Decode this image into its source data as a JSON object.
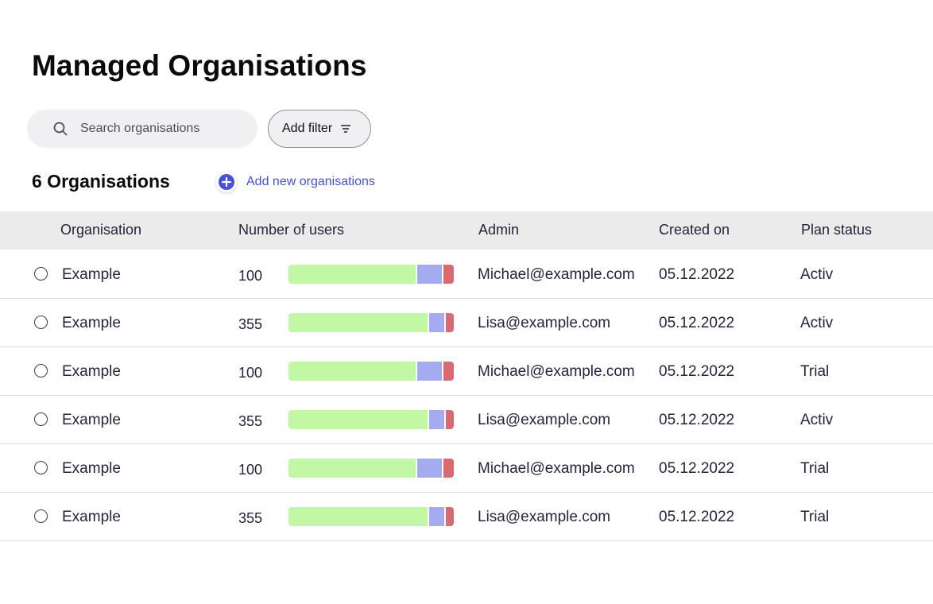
{
  "page": {
    "title": "Managed Organisations"
  },
  "search": {
    "placeholder": "Search organisations",
    "icon": "search-icon"
  },
  "filter": {
    "label": "Add filter",
    "icon": "filter-lines-icon"
  },
  "summary": {
    "count_label": "6 Organisations",
    "add_label": "Add new organisations",
    "add_icon": "plus-circle-icon"
  },
  "colors": {
    "accent": "#4751d6",
    "bar_green": "#c2f7a3",
    "bar_purple": "#a5abf0",
    "bar_red": "#d96a72"
  },
  "table": {
    "columns": [
      "Organisation",
      "Number of users",
      "Admin",
      "Created on",
      "Plan status"
    ],
    "rows": [
      {
        "org": "Example",
        "users": "100",
        "usage": [
          0.77,
          0.16,
          0.07
        ],
        "admin": "Michael@example.com",
        "created": "05.12.2022",
        "plan": "Activ"
      },
      {
        "org": "Example",
        "users": "355",
        "usage": [
          0.84,
          0.1,
          0.06
        ],
        "admin": "Lisa@example.com",
        "created": "05.12.2022",
        "plan": "Activ"
      },
      {
        "org": "Example",
        "users": "100",
        "usage": [
          0.77,
          0.16,
          0.07
        ],
        "admin": "Michael@example.com",
        "created": "05.12.2022",
        "plan": "Trial"
      },
      {
        "org": "Example",
        "users": "355",
        "usage": [
          0.84,
          0.1,
          0.06
        ],
        "admin": "Lisa@example.com",
        "created": "05.12.2022",
        "plan": "Activ"
      },
      {
        "org": "Example",
        "users": "100",
        "usage": [
          0.77,
          0.16,
          0.07
        ],
        "admin": "Michael@example.com",
        "created": "05.12.2022",
        "plan": "Trial"
      },
      {
        "org": "Example",
        "users": "355",
        "usage": [
          0.84,
          0.1,
          0.06
        ],
        "admin": "Lisa@example.com",
        "created": "05.12.2022",
        "plan": "Trial"
      }
    ]
  }
}
